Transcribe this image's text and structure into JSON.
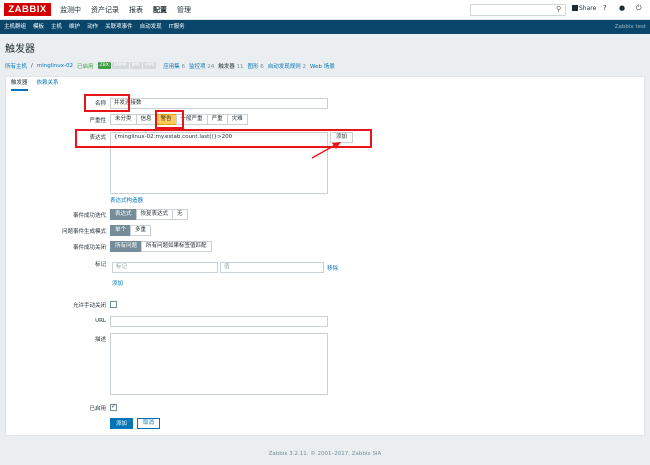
{
  "header": {
    "logo": "ZABBIX",
    "menu": [
      "监测中",
      "资产记录",
      "报表",
      "配置",
      "管理"
    ],
    "active_menu": "配置",
    "share_label": "Share",
    "help": "?"
  },
  "submenu": {
    "items": [
      "主机群组",
      "模板",
      "主机",
      "维护",
      "动作",
      "关联项事件",
      "自动发现",
      "IT服务"
    ],
    "right": "Zabbix test"
  },
  "page_title": "触发器",
  "breadcrumbs": {
    "all_hosts": "所有主机",
    "separator": "/",
    "host": "minglinux-02",
    "status": "已启用",
    "tags": [
      "ZBX",
      "SNMP",
      "JMX",
      "IPMI"
    ],
    "links": [
      {
        "label": "应用集",
        "count": "6"
      },
      {
        "label": "监控项",
        "count": "24"
      },
      {
        "label": "触发器",
        "count": "11"
      },
      {
        "label": "图形",
        "count": "6"
      },
      {
        "label": "自动发现规则",
        "count": "2"
      },
      {
        "label": "Web 场景",
        "count": ""
      }
    ]
  },
  "tabs": [
    "触发器",
    "依赖关系"
  ],
  "form": {
    "name_label": "名称",
    "name_value": "并发连接数",
    "severity_label": "严重性",
    "severity_options": [
      "未分类",
      "信息",
      "警告",
      "一般严重",
      "严重",
      "灾难"
    ],
    "severity_selected": "警告",
    "expression_label": "表达式",
    "expression_value": "{minglinux-02:my.estab.count.last()}>200",
    "add_button": "添加",
    "expression_builder": "表达式构造器",
    "ok_event_label": "事件成功迭代",
    "ok_event_options": [
      "表达式",
      "恢复表达式",
      "无"
    ],
    "problem_mode_label": "问题事件生成模式",
    "problem_mode_options": [
      "单个",
      "多重"
    ],
    "ok_close_label": "事件成功关闭",
    "ok_close_options": [
      "所有问题",
      "所有问题如果标签值匹配"
    ],
    "tags_label": "标记",
    "tag_placeholder": "标记",
    "value_placeholder": "值",
    "remove_link": "移除",
    "add_link": "添加",
    "manual_close_label": "允许手动关闭",
    "url_label": "URL",
    "description_label": "描述",
    "enabled_label": "已启用",
    "submit_button": "添加",
    "cancel_button": "取消"
  },
  "footer": "Zabbix 3.2.11. © 2001–2017, Zabbix SIA",
  "colors": {
    "accent": "#0275b8",
    "header_bar": "#0a466a",
    "logo": "#d40000",
    "highlight": "#e8141a",
    "warning": "#ffc859"
  }
}
